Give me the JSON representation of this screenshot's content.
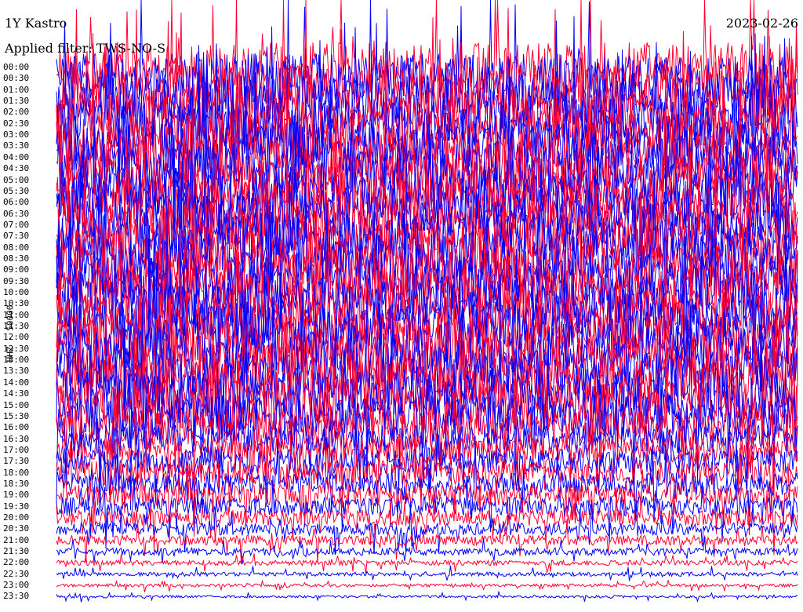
{
  "chart_data": {
    "type": "line",
    "title": "1Y Kastro",
    "date": "2023-02-26",
    "filter_text": "Applied filter: TWS-NO-S",
    "ylabel": "HHZ - 50000",
    "tick_labels": [
      "00:00",
      "00:30",
      "01:00",
      "01:30",
      "02:00",
      "02:30",
      "03:00",
      "03:30",
      "04:00",
      "04:30",
      "05:00",
      "05:30",
      "06:00",
      "06:30",
      "07:00",
      "07:30",
      "08:00",
      "08:30",
      "09:00",
      "09:30",
      "10:00",
      "10:30",
      "11:00",
      "11:30",
      "12:00",
      "12:30",
      "13:00",
      "13:30",
      "14:00",
      "14:30",
      "15:00",
      "15:30",
      "16:00",
      "16:30",
      "17:00",
      "17:30",
      "18:00",
      "18:30",
      "19:00",
      "19:30",
      "20:00",
      "20:30",
      "21:00",
      "21:30",
      "22:00",
      "22:30",
      "23:00",
      "23:30"
    ],
    "trace_colors": [
      "#ff0033",
      "#0000ff"
    ],
    "amplitude_profile": [
      1.0,
      1.0,
      1.0,
      1.0,
      1.0,
      1.0,
      1.0,
      1.0,
      1.0,
      1.0,
      1.0,
      1.0,
      1.0,
      1.0,
      1.0,
      1.0,
      1.0,
      1.0,
      1.0,
      1.0,
      1.0,
      1.0,
      1.0,
      1.0,
      1.0,
      1.0,
      1.0,
      1.0,
      1.0,
      1.0,
      0.95,
      0.85,
      0.7,
      0.55,
      0.5,
      0.5,
      0.48,
      0.45,
      0.42,
      0.38,
      0.32,
      0.25,
      0.2,
      0.15,
      0.1,
      0.08,
      0.06,
      0.05
    ]
  }
}
